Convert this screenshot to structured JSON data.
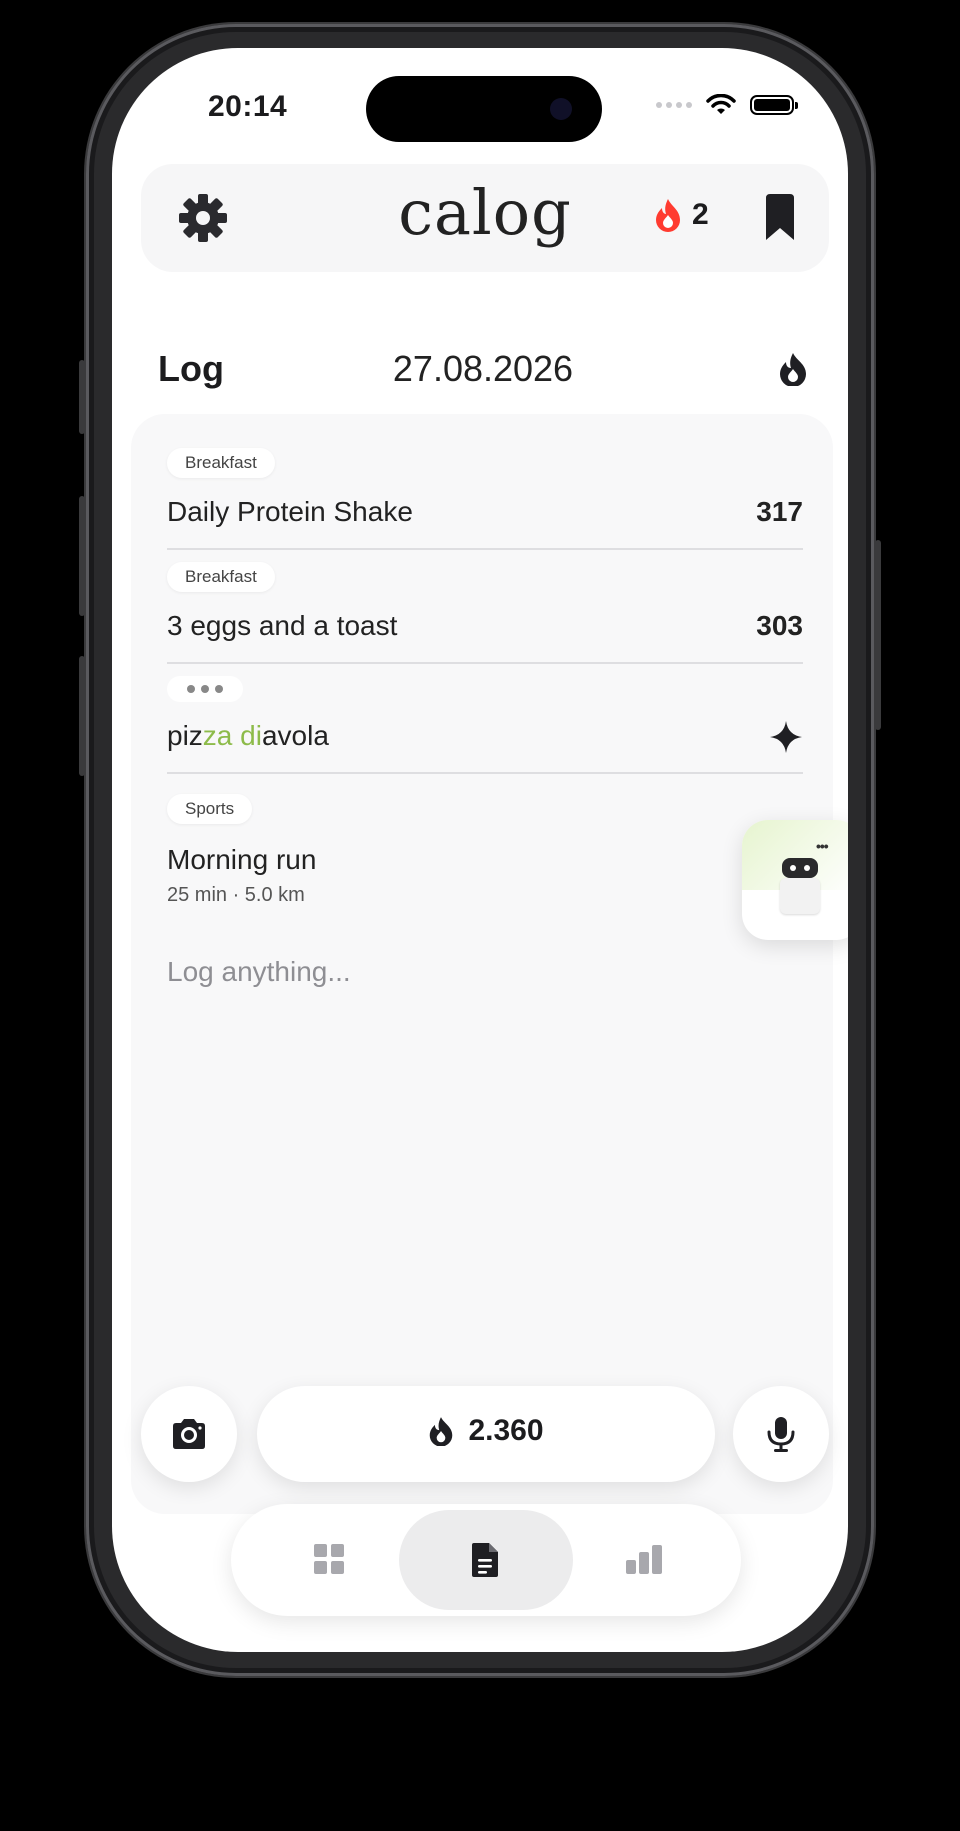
{
  "status_bar": {
    "time": "20:14"
  },
  "header": {
    "app_name": "calog",
    "streak_count": "2",
    "icons": [
      "gear-icon",
      "flame-icon",
      "bookmark-icon"
    ],
    "streak_icon_color": "#ff3b30"
  },
  "log": {
    "title": "Log",
    "date": "27.08.2026",
    "entries": [
      {
        "tag": "Breakfast",
        "name": "Daily Protein Shake",
        "calories": "317"
      },
      {
        "tag": "Breakfast",
        "name": "3 eggs and a toast",
        "calories": "303"
      },
      {
        "name_parts": [
          "piz",
          "za",
          " ",
          "di",
          "avola"
        ],
        "status": "processing"
      },
      {
        "tag": "Sports",
        "name": "Morning run",
        "detail": "25 min · 5.0 km"
      }
    ],
    "placeholder": "Log anything..."
  },
  "bottom": {
    "total_calories": "2.360",
    "tabs": [
      "dashboard-tab",
      "log-tab",
      "stats-tab"
    ],
    "active_tab": "log-tab"
  },
  "colors": {
    "highlight_green": "#8dbb4a",
    "card_bg": "#f8f8f9"
  }
}
